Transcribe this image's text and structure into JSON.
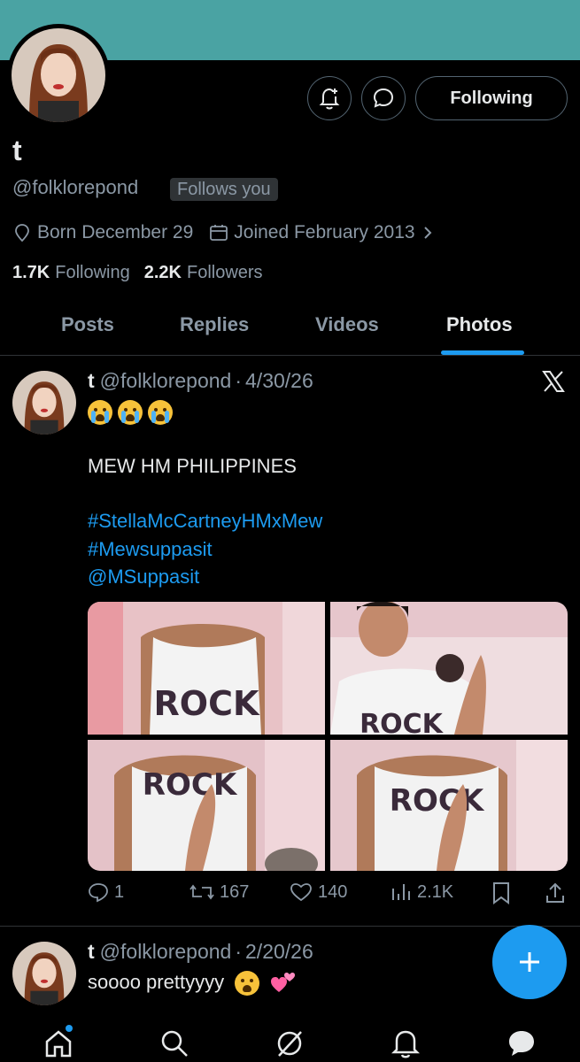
{
  "profile": {
    "name": "t",
    "handle": "@folklorepond",
    "follows_you": "Follows you",
    "born": "Born December 29",
    "joined": "Joined February 2013",
    "following_count": "1.7K",
    "following_label": "Following",
    "followers_count": "2.2K",
    "followers_label": "Followers",
    "follow_button": "Following"
  },
  "tabs": [
    {
      "label": "Posts"
    },
    {
      "label": "Replies"
    },
    {
      "label": "Videos"
    },
    {
      "label": "Photos",
      "active": true
    }
  ],
  "posts": [
    {
      "name": "t",
      "handle": "@folklorepond",
      "sep": "·",
      "date": "4/30/26",
      "line1": "MEW HM PHILIPPINES",
      "hashtag1": "#StellaMcCartneyHMxMew",
      "hashtag2": "#Mewsuppasit",
      "mention": "@MSuppasit",
      "photo_text": "ROCK",
      "replies": "1",
      "reposts": "167",
      "likes": "140",
      "views": "2.1K"
    },
    {
      "name": "t",
      "handle": "@folklorepond",
      "sep": "·",
      "date": "2/20/26",
      "text": "soooo prettyyyy"
    }
  ],
  "colors": {
    "banner": "#4aa3a3",
    "accent": "#1d9bf0",
    "background": "#000000",
    "muted_text": "#8b98a5"
  },
  "icons": [
    "bell-plus-icon",
    "message-icon",
    "location-icon",
    "calendar-icon",
    "chevron-right-icon",
    "x-logo-icon",
    "reply-icon",
    "repost-icon",
    "like-icon",
    "views-icon",
    "bookmark-icon",
    "share-icon",
    "plus-icon",
    "home-icon",
    "search-icon",
    "grok-icon",
    "notifications-icon",
    "messages-icon"
  ]
}
